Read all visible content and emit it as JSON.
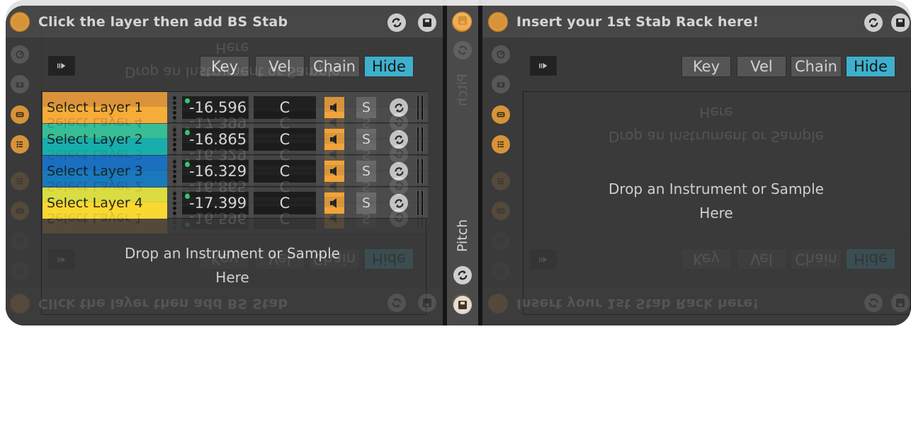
{
  "left_rack": {
    "title": "Click the layer then add BS Stab",
    "toolbar": {
      "key": "Key",
      "vel": "Vel",
      "chain": "Chain",
      "hide": "Hide"
    },
    "layers": [
      {
        "name": "Select Layer 1",
        "volume": "-16.596",
        "key": "C",
        "solo": "S",
        "color": "#f6a33a"
      },
      {
        "name": "Select Layer 2",
        "volume": "-16.865",
        "key": "C",
        "solo": "S",
        "color": "#18b9a9"
      },
      {
        "name": "Select Layer 3",
        "volume": "-16.329",
        "key": "C",
        "solo": "S",
        "color": "#1a6fc0"
      },
      {
        "name": "Select Layer 4",
        "volume": "-17.399",
        "key": "C",
        "solo": "S",
        "color": "#fbe231"
      }
    ],
    "drop_line1": "Drop an Instrument or Sample",
    "drop_line2": "Here"
  },
  "middle": {
    "pitch_label": "Pitch"
  },
  "right_rack": {
    "title": "Insert your 1st Stab Rack here!",
    "toolbar": {
      "key": "Key",
      "vel": "Vel",
      "chain": "Chain",
      "hide": "Hide"
    },
    "drop_line1": "Drop an Instrument or Sample",
    "drop_line2": "Here"
  },
  "colors": {
    "accent_orange": "#f2a33a",
    "hide_active": "#3fc5e6",
    "panel_bg": "#4a4a4a",
    "chain_bg": "#3a3a3a"
  },
  "icons": {
    "power": "power-button",
    "cycle": "hot-swap-icon",
    "save": "save-icon",
    "macro": "macro-icon",
    "snapshot": "camera-icon",
    "chain_list": "chain-list-icon",
    "show_chains": "show-chains-icon",
    "play": "play-arrow-icon"
  }
}
